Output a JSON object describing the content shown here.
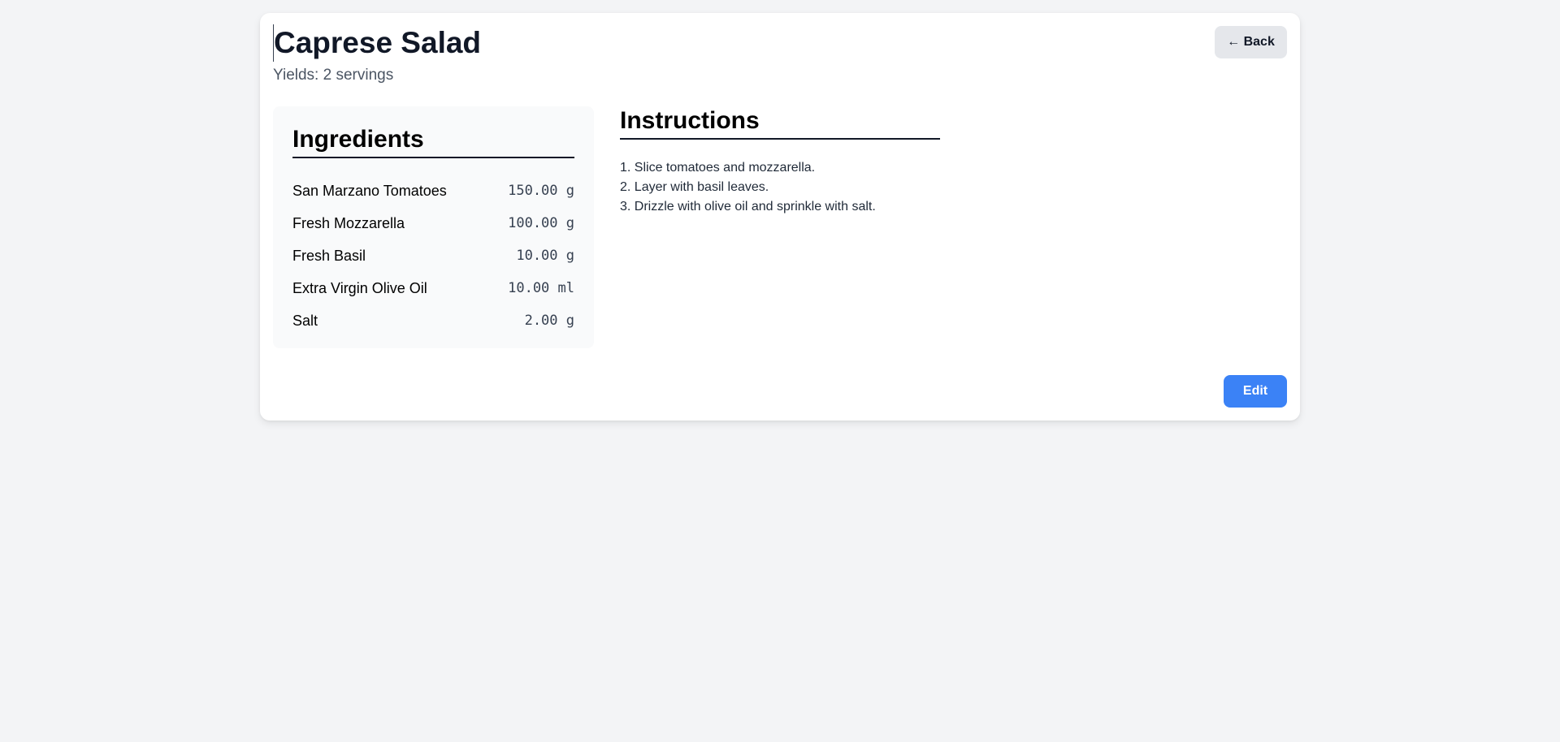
{
  "recipe": {
    "title": "Caprese Salad",
    "yields": "Yields: 2 servings"
  },
  "actions": {
    "back_label": "← Back",
    "edit_label": "Edit"
  },
  "ingredients": {
    "heading": "Ingredients",
    "items": [
      {
        "name": "San Marzano Tomatoes",
        "qty": "150.00 g"
      },
      {
        "name": "Fresh Mozzarella",
        "qty": "100.00 g"
      },
      {
        "name": "Fresh Basil",
        "qty": "10.00 g"
      },
      {
        "name": "Extra Virgin Olive Oil",
        "qty": "10.00 ml"
      },
      {
        "name": "Salt",
        "qty": "2.00 g"
      }
    ]
  },
  "instructions": {
    "heading": "Instructions",
    "steps": [
      "1. Slice tomatoes and mozzarella.",
      "2. Layer with basil leaves.",
      "3. Drizzle with olive oil and sprinkle with salt."
    ]
  },
  "colors": {
    "background": "#f3f4f6",
    "card": "#ffffff",
    "primary_button": "#3b82f6",
    "secondary_button": "#e5e7eb"
  }
}
